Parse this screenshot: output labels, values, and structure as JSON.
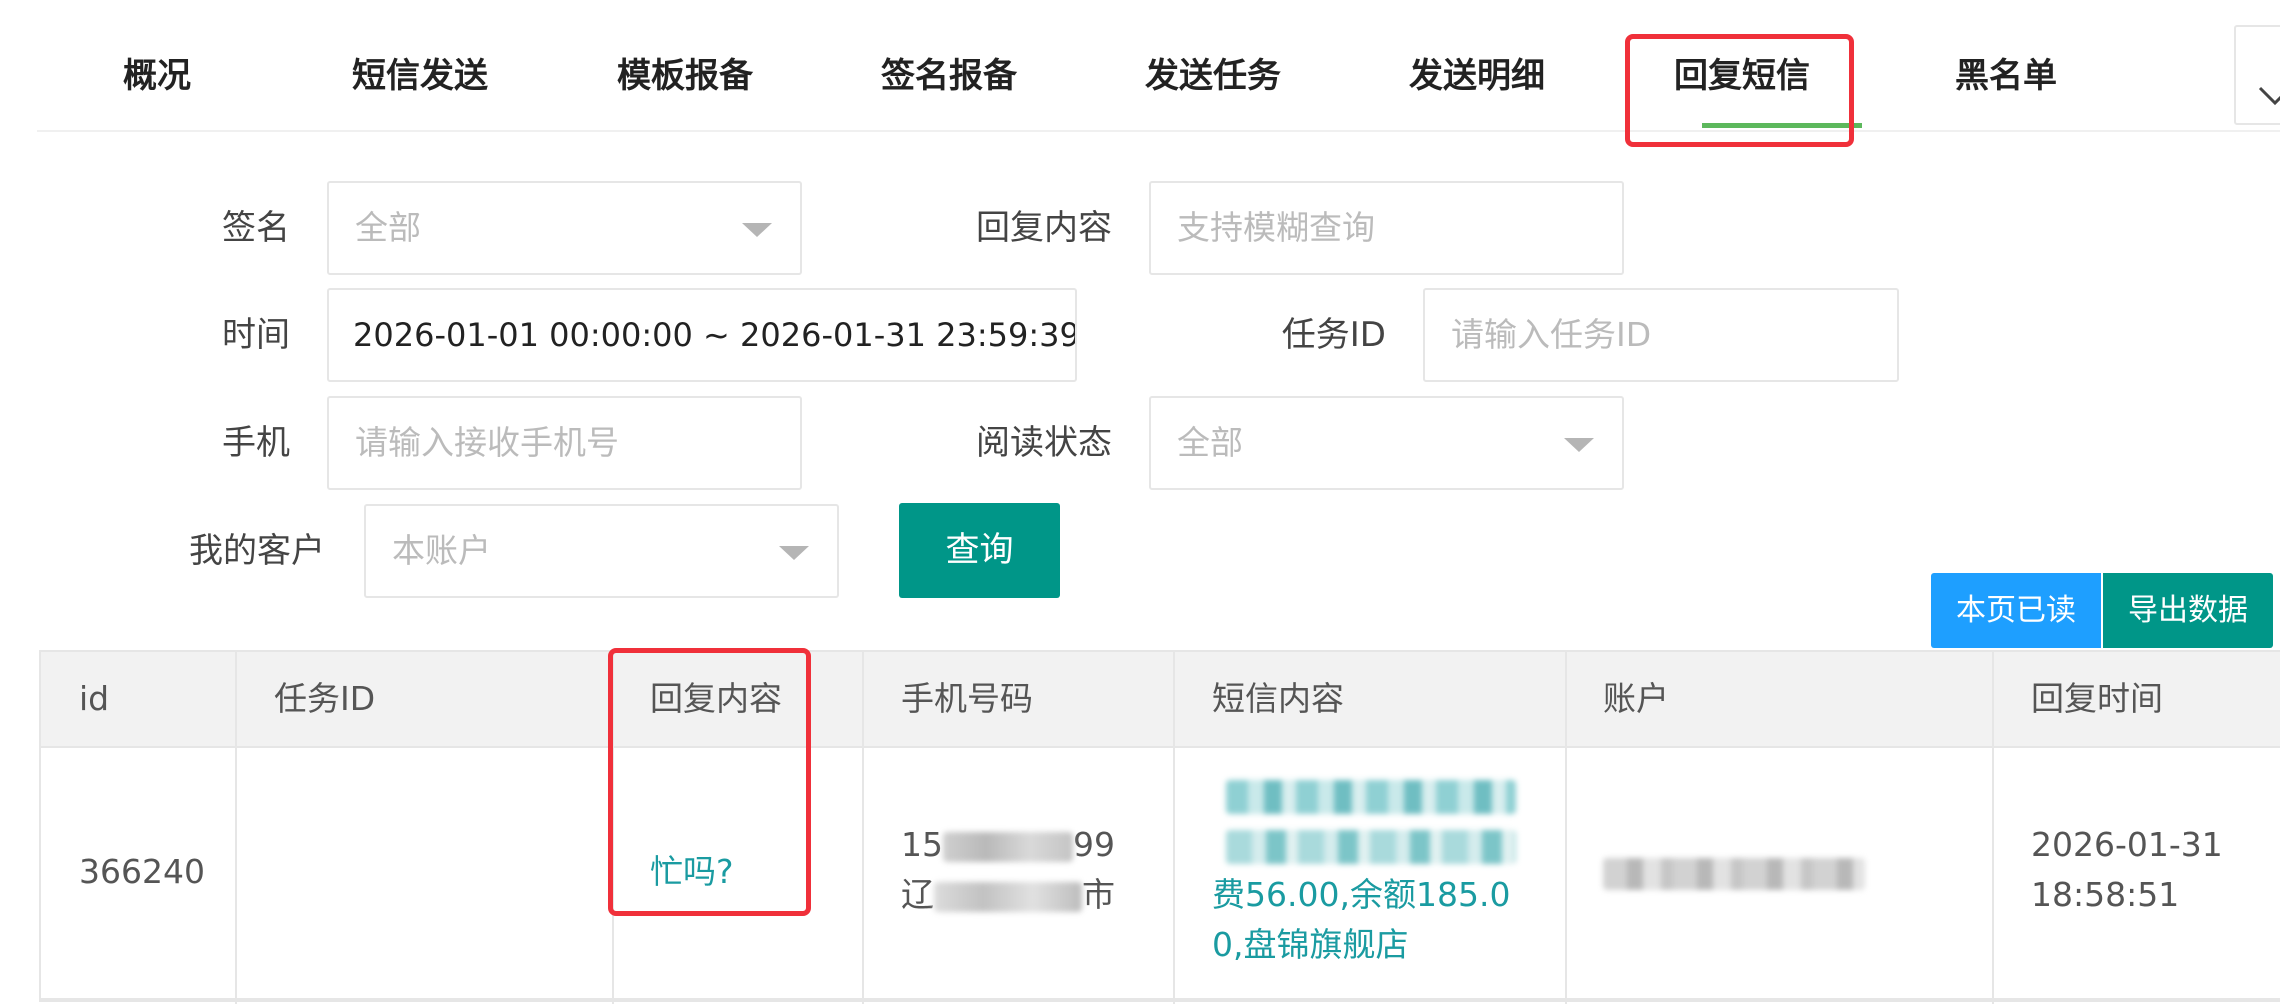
{
  "tabs": [
    "概况",
    "短信发送",
    "模板报备",
    "签名报备",
    "发送任务",
    "发送明细",
    "回复短信",
    "黑名单"
  ],
  "active_tab": "回复短信",
  "filters": {
    "signature": {
      "label": "签名",
      "value": "全部"
    },
    "reply_content": {
      "label": "回复内容",
      "placeholder": "支持模糊查询"
    },
    "time": {
      "label": "时间",
      "value": "2026-01-01 00:00:00 ~ 2026-01-31 23:59:39"
    },
    "task_id": {
      "label": "任务ID",
      "placeholder": "请输入任务ID"
    },
    "phone": {
      "label": "手机",
      "placeholder": "请输入接收手机号"
    },
    "read_status": {
      "label": "阅读状态",
      "value": "全部"
    },
    "customer": {
      "label": "我的客户",
      "value": "本账户"
    },
    "query_button": "查询"
  },
  "actions": {
    "mark_read": "本页已读",
    "export": "导出数据"
  },
  "table": {
    "columns": [
      "id",
      "任务ID",
      "回复内容",
      "手机号码",
      "短信内容",
      "账户",
      "回复时间"
    ],
    "rows": [
      {
        "id": "366240",
        "task_id": "",
        "reply": "忙吗?",
        "phone_prefix": "15",
        "phone_suffix": "99",
        "region_prefix": "辽",
        "region_suffix": "市",
        "sms_line3": "费56.00,余额185.0",
        "sms_line4": "0,盘锦旗舰店",
        "reply_date": "2026-01-31",
        "reply_clock": "18:58:51"
      }
    ]
  },
  "colors": {
    "accent_green": "#009688",
    "accent_blue": "#1e9fff",
    "tab_underline": "#5cb85c",
    "highlight": "#f0303a",
    "link": "#1a9ba1"
  }
}
